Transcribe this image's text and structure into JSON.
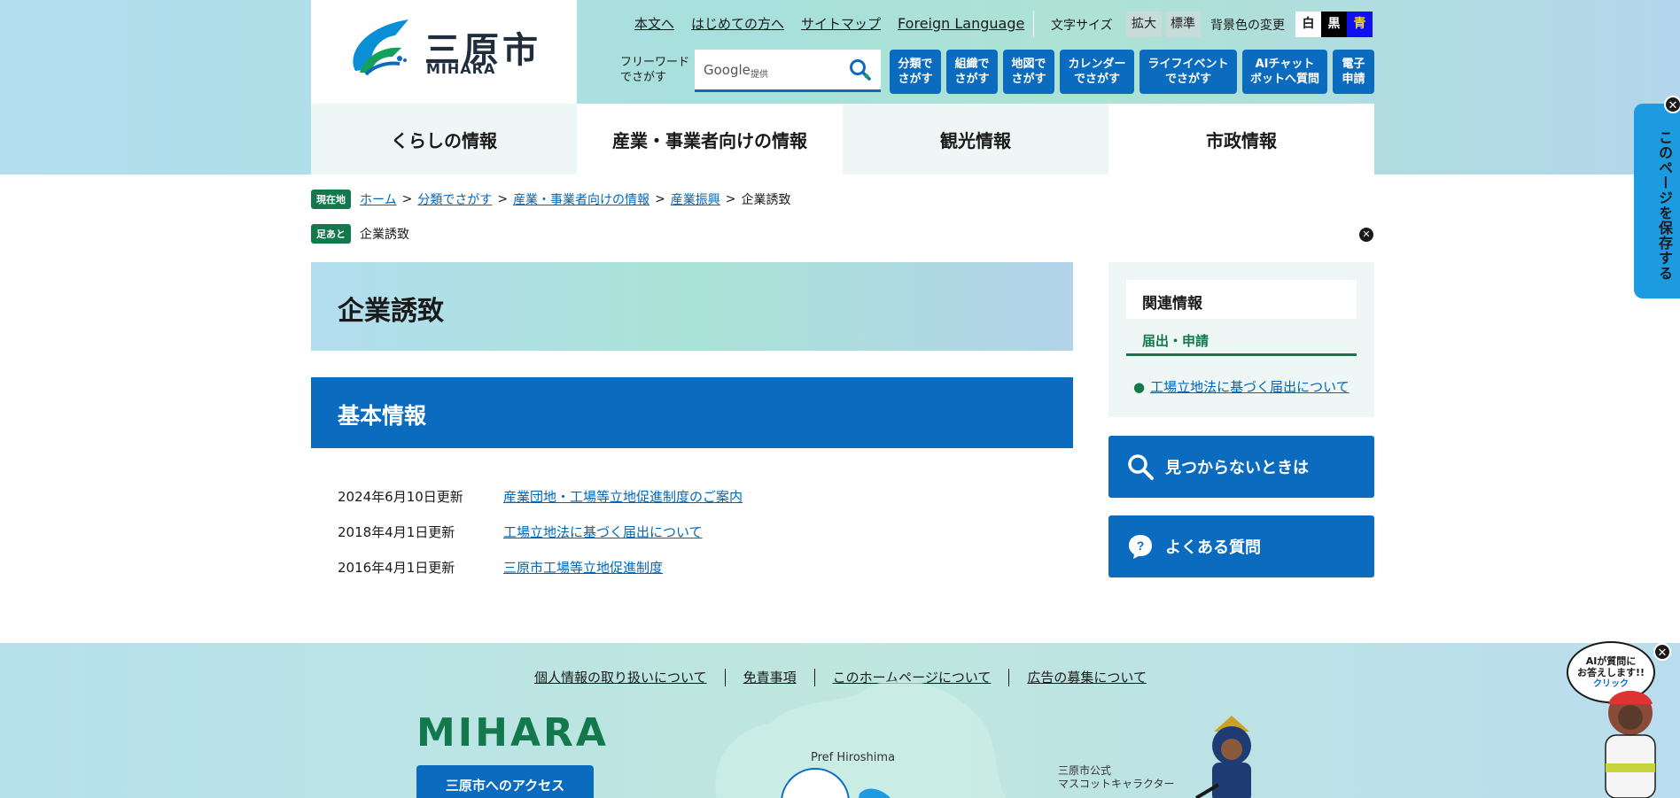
{
  "logo": {
    "jp": "三原市",
    "en": "MIHARA"
  },
  "util_links": [
    "本文へ",
    "はじめての方へ",
    "サイトマップ",
    "Foreign Language"
  ],
  "font_size": {
    "label": "文字サイズ",
    "large": "拡大",
    "normal": "標準"
  },
  "bg_color": {
    "label": "背景色の変更",
    "white": "白",
    "black": "黒",
    "blue": "青"
  },
  "search": {
    "label_line1": "フリーワード",
    "label_line2": "でさがす",
    "google": "Google",
    "provided": "提供"
  },
  "nav_buttons": [
    {
      "l1": "分類で",
      "l2": "さがす"
    },
    {
      "l1": "組織で",
      "l2": "さがす"
    },
    {
      "l1": "地図で",
      "l2": "さがす"
    },
    {
      "l1": "カレンダー",
      "l2": "でさがす"
    },
    {
      "l1": "ライフイベント",
      "l2": "でさがす"
    },
    {
      "l1": "AIチャット",
      "l2": "ボットへ質問"
    },
    {
      "l1": "電子",
      "l2": "申請"
    }
  ],
  "global_nav": [
    "くらしの情報",
    "産業・事業者向けの情報",
    "観光情報",
    "市政情報"
  ],
  "breadcrumb": {
    "tag": "現在地",
    "items": [
      "ホーム",
      "分類でさがす",
      "産業・事業者向けの情報",
      "産業振興"
    ],
    "current": "企業誘致"
  },
  "footprint": {
    "tag": "足あと",
    "item": "企業誘致"
  },
  "page_title": "企業誘致",
  "section_title": "基本情報",
  "updates": [
    {
      "date": "2024年6月10日更新",
      "title": "産業団地・工場等立地促進制度のご案内"
    },
    {
      "date": "2018年4月1日更新",
      "title": "工場立地法に基づく届出について"
    },
    {
      "date": "2016年4月1日更新",
      "title": "三原市工場等立地促進制度"
    }
  ],
  "related": {
    "heading": "関連情報",
    "subheading": "届出・申請",
    "item": "工場立地法に基づく届出について"
  },
  "side_buttons": {
    "not_found": "見つからないときは",
    "faq": "よくある質問"
  },
  "save_tab": "このページを保存する",
  "footer": {
    "links": [
      "個人情報の取り扱いについて",
      "免責事項",
      "このホームページについて",
      "広告の募集について"
    ],
    "logo": "MIHARA",
    "access_button": "三原市へのアクセス",
    "pref_label": "Pref Hiroshima",
    "mascot_line1": "三原市公式",
    "mascot_line2": "マスコットキャラクター"
  },
  "ai_helper": {
    "line1": "AIが質問に",
    "line2": "お答えします!!",
    "click": "クリック"
  },
  "colors": {
    "primary_blue": "#0a6bbf",
    "green": "#13794d"
  }
}
